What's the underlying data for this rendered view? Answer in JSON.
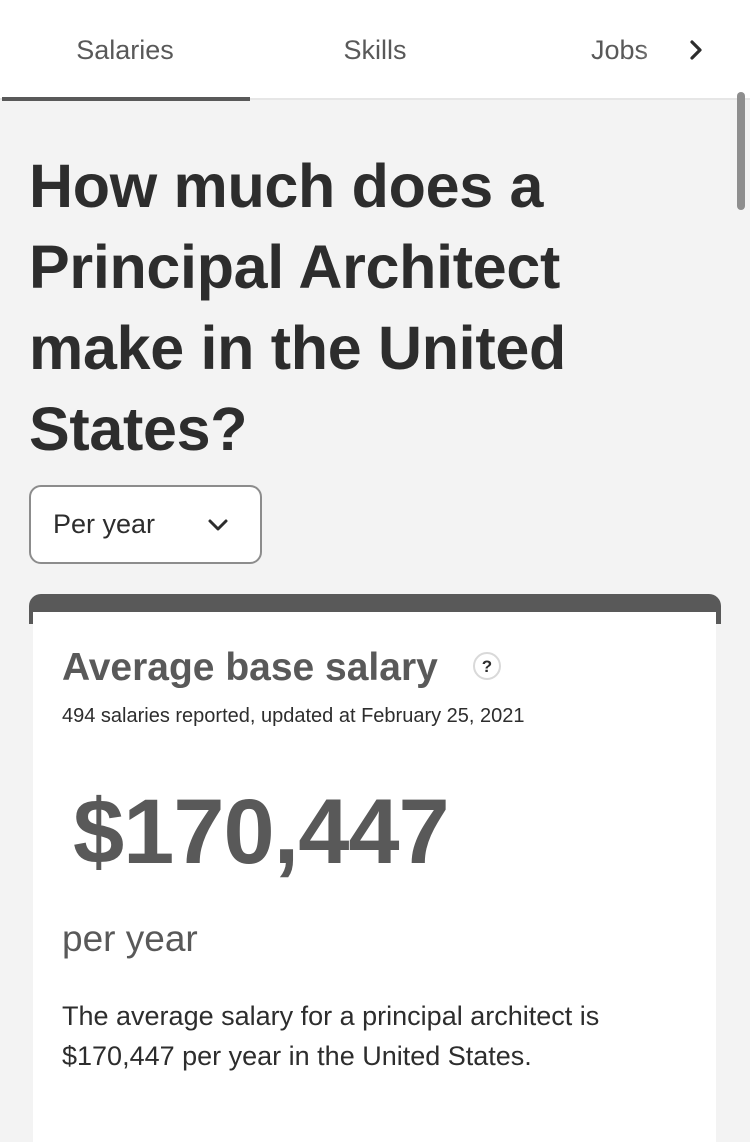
{
  "tabs": [
    {
      "label": "Salaries",
      "active": true
    },
    {
      "label": "Skills",
      "active": false
    },
    {
      "label": "Jobs",
      "active": false
    }
  ],
  "icons": {
    "tab_scroll": "chevron-right-icon",
    "period_dropdown": "chevron-down-icon",
    "help": "question-circle-icon"
  },
  "title": "How much does a Principal Architect make in the United States?",
  "period_select": {
    "value": "Per year"
  },
  "salary_card": {
    "heading": "Average base salary",
    "subtitle": "494 salaries reported, updated at February 25, 2021",
    "amount": "$170,447",
    "period": "per year",
    "description": "The average salary for a principal architect is $170,447 per year in the United States."
  },
  "colors": {
    "text_primary": "#2d2d2d",
    "text_secondary": "#595959",
    "page_background": "#f3f3f3",
    "card_background": "#ffffff",
    "card_accent": "#595959"
  }
}
